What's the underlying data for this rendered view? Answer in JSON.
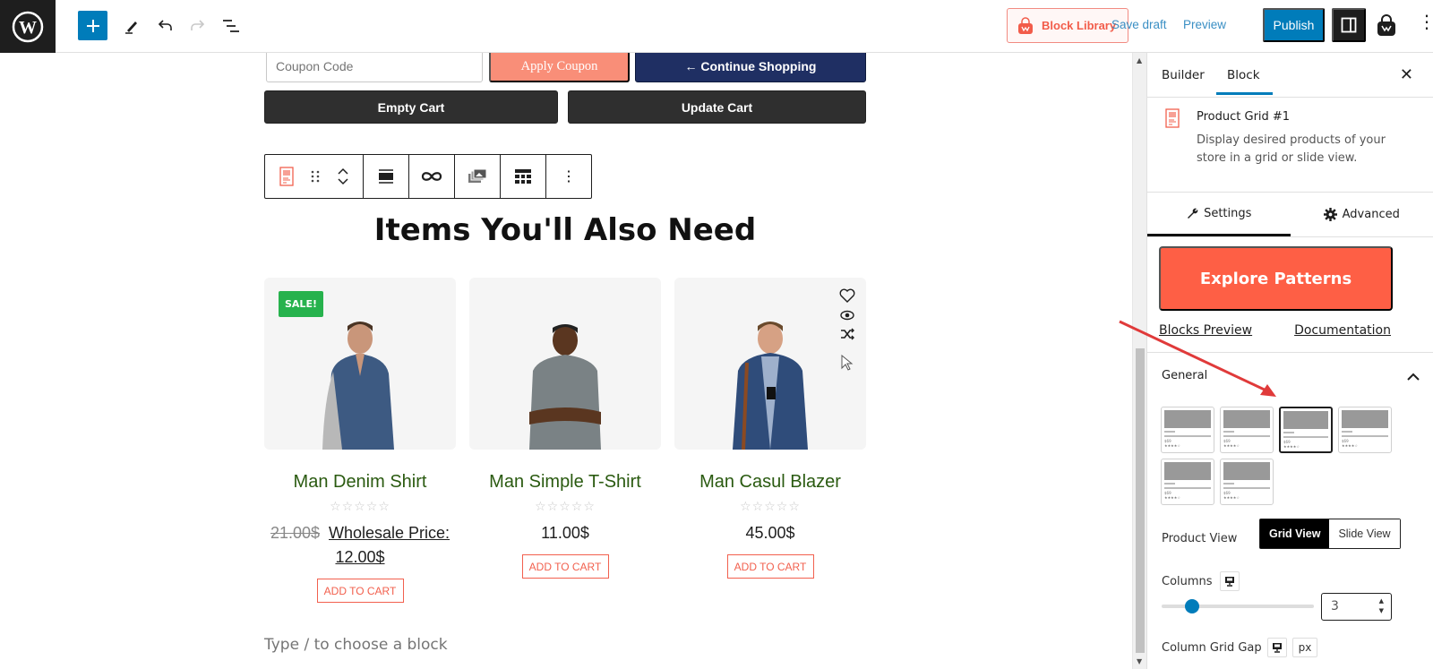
{
  "topbar": {
    "block_library_label": "Block Library",
    "save_draft_label": "Save draft",
    "preview_label": "Preview",
    "publish_label": "Publish"
  },
  "cart": {
    "coupon_placeholder": "Coupon Code",
    "apply_coupon_label": "Apply Coupon",
    "continue_shopping_label": "← Continue Shopping",
    "empty_cart_label": "Empty Cart",
    "update_cart_label": "Update Cart"
  },
  "section": {
    "heading": "Items You'll Also Need"
  },
  "products": [
    {
      "name": "Man Denim Shirt",
      "badge": "SALE!",
      "old_price": "21.00$",
      "price": "Wholesale Price: 12.00$",
      "rating": 0,
      "button": "ADD TO CART"
    },
    {
      "name": "Man Simple T-Shirt",
      "price": "11.00$",
      "rating": 0,
      "button": "ADD TO CART"
    },
    {
      "name": "Man Casul Blazer",
      "price": "45.00$",
      "rating": 0,
      "button": "ADD TO CART"
    }
  ],
  "stars_glyph": "☆☆☆☆☆",
  "editor": {
    "type_placeholder": "Type / to choose a block"
  },
  "sidebar": {
    "tabs": [
      "Builder",
      "Block"
    ],
    "active_tab": "Block",
    "block_title": "Product Grid #1",
    "block_desc": "Display desired products of your store in a grid or slide view.",
    "settings_tabs": [
      "Settings",
      "Advanced"
    ],
    "explore_label": "Explore Patterns",
    "blocks_preview_label": "Blocks Preview",
    "documentation_label": "Documentation",
    "general_label": "General",
    "layout_selected_index": 3,
    "product_view_label": "Product View",
    "product_view_options": [
      "Grid View",
      "Slide View"
    ],
    "product_view_selected": "Grid View",
    "columns_label": "Columns",
    "columns_value": "3",
    "columns_slider_fraction": 0.2,
    "column_gap_label": "Column Grid Gap",
    "unit": "px"
  },
  "colors": {
    "accent": "#007cba",
    "brand_orange": "#fe5f45",
    "sale_green": "#27b24d",
    "product_title": "#2a5a10"
  }
}
